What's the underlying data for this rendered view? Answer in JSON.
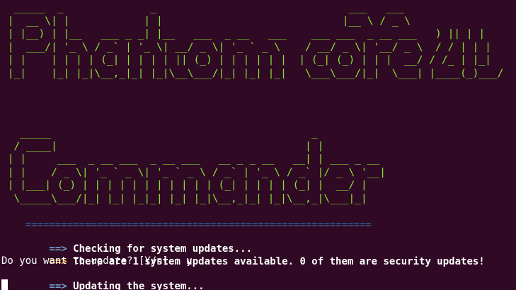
{
  "terminal": {
    "background_color": "#300a24",
    "logo_color": "#8ae234",
    "logo_top": [
      "  _____  _              _                               ___   ___ ",
      " |  __ \\| |            | |                             |__ \\ / _ \\",
      " | |__) | |__   ___ _ _| |__   ___  _ __   ___    ___ ___  _ __ ___   ) || | |",
      " |  ___/| '_ \\ / _` | '_ \\| __/ _ \\| '_ ` _ \\    / __/ _ \\| '__/ _ \\  / / | | |",
      " | |    | | | | (_| | | | | || (_) | | | | | |  | (_| (_) | | |  __/ / /_ | |_|",
      " |_|    |_| |_|\\__,_|_| |_|\\__\\___/|_| |_| |_|   \\___\\___/|_|  \\___| |____(_)___/"
    ],
    "logo_bottom": [
      "   _____                                          _",
      "  / ____|                                        | |",
      " | |     ___  _ __ ___  _ __ ___   __ _ _ __   __| | ___ _ __",
      " | |    / _ \\| '_ ` _ \\| '_ ` _ \\ / _` | '_ \\ / _` |/ _ \\ '__|",
      " | |___| (_) | | | | | | | | | | | (_| | | | | (_| |  __/ |",
      "  \\_____\\___/|_| |_| |_|_| |_| |_|\\__,_|_| |_|\\__,_|\\___|_|"
    ],
    "separator": "    ==========================================================",
    "line1": {
      "arrow": "    ==> ",
      "text": "Checking for system updates..."
    },
    "line2": {
      "arrow": "    ==> ",
      "text": "There are 1 system updates available. 0 of them are security updates!"
    },
    "prompt": "Do you want to update? [Y/n] : y",
    "line3": {
      "arrow": "    ==> ",
      "text": "Updating the system..."
    }
  }
}
